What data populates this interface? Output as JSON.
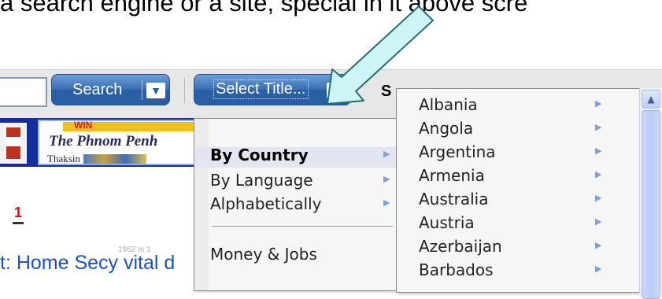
{
  "caption": "a search engine or a site, special in it above scre",
  "toolbar": {
    "search_label": "Search",
    "select_title_label": "Select Title...",
    "bold_letter": "S"
  },
  "logo": {
    "win_text": "WIN",
    "newspaper_name": "The Phnom Penh",
    "subtitle": "Thaksin"
  },
  "red_number": "1",
  "headline": "t: Home Secy vital d",
  "faint_text": "1962 m 1",
  "menu_primary": {
    "items": [
      {
        "label": "By Country",
        "active": true,
        "has_submenu": true
      },
      {
        "label": "By Language",
        "active": false,
        "has_submenu": true
      },
      {
        "label": "Alphabetically",
        "active": false,
        "has_submenu": true
      },
      {
        "label": "Money & Jobs",
        "active": false,
        "has_submenu": false
      }
    ]
  },
  "menu_countries": {
    "items": [
      "Albania",
      "Angola",
      "Argentina",
      "Armenia",
      "Australia",
      "Austria",
      "Azerbaijan",
      "Barbados"
    ]
  },
  "icons": {
    "dropdown": "chevron-down-icon",
    "submenu": "submenu-arrow-icon",
    "scroll_up": "scroll-up-arrow-icon",
    "pointer": "callout-arrow-icon"
  },
  "colors": {
    "button_blue": "#2b5fa5",
    "arrow_fill": "#cdf4f7",
    "headline_blue": "#1f52b8",
    "menu_bg": "#f6f6f6"
  }
}
